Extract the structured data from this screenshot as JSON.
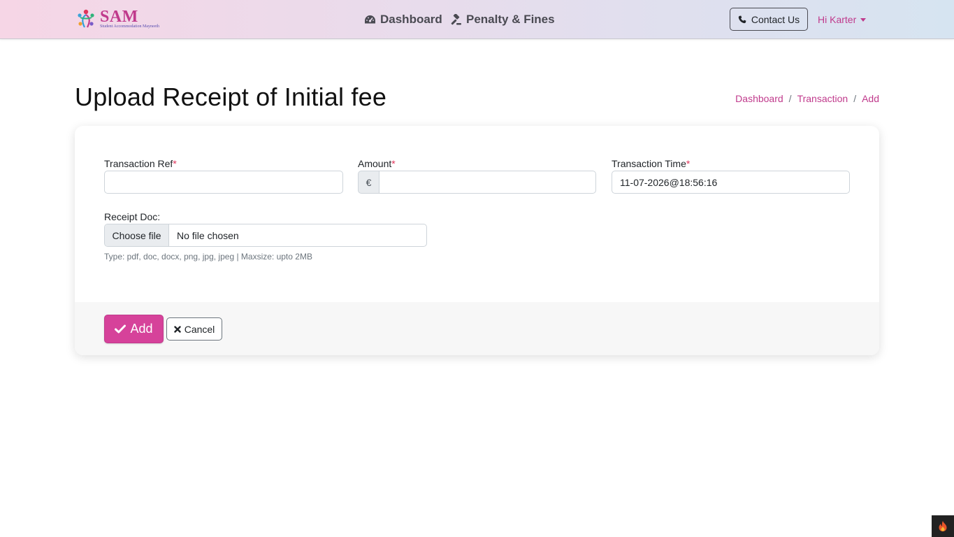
{
  "brand": {
    "name": "SAM",
    "tagline": "Student Accommodation Mayneeth",
    "accent": "#c03a8c"
  },
  "nav": {
    "dashboard_label": "Dashboard",
    "penalty_label": "Penalty & Fines",
    "contact_label": "Contact Us",
    "user_label": "Hi Karter"
  },
  "page": {
    "title": "Upload Receipt of Initial fee"
  },
  "breadcrumb": {
    "items": [
      "Dashboard",
      "Transaction",
      "Add"
    ],
    "separator": "/"
  },
  "form": {
    "transaction_ref": {
      "label": "Transaction Ref",
      "required_mark": "*",
      "value": ""
    },
    "amount": {
      "label": "Amount",
      "required_mark": "*",
      "currency": "€",
      "value": ""
    },
    "transaction_time": {
      "label": "Transaction Time",
      "required_mark": "*",
      "value": "11-07-2026@18:56:16"
    },
    "receipt_doc": {
      "label": "Receipt Doc:",
      "button_label": "Choose file",
      "file_name": "No file chosen",
      "hint": "Type: pdf, doc, docx, png, jpg, jpeg | Maxsize: upto 2MB"
    }
  },
  "actions": {
    "add_label": "Add",
    "cancel_label": "Cancel",
    "add_color": "#d6429a"
  },
  "icons": {
    "dashboard": "tachometer-icon",
    "penalty": "gavel-icon",
    "contact": "phone-icon",
    "add": "check-icon",
    "cancel": "close-icon",
    "corner": "flame-icon"
  }
}
